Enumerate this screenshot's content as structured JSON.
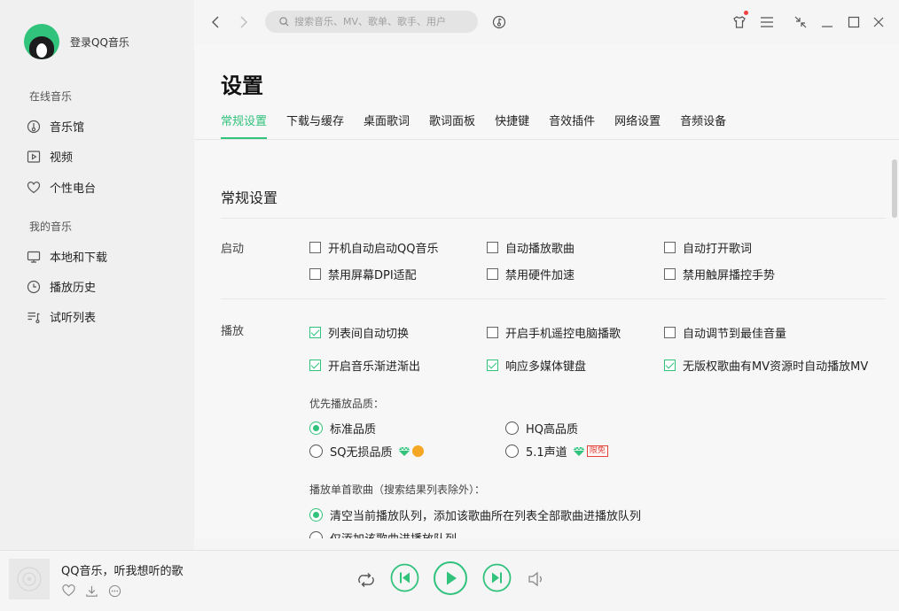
{
  "sidebar": {
    "login_text": "登录QQ音乐",
    "section_online": "在线音乐",
    "section_mine": "我的音乐",
    "items": [
      {
        "label": "音乐馆",
        "icon": "music-hall-icon"
      },
      {
        "label": "视频",
        "icon": "video-icon"
      },
      {
        "label": "个性电台",
        "icon": "heart-radio-icon"
      },
      {
        "label": "本地和下载",
        "icon": "monitor-icon"
      },
      {
        "label": "播放历史",
        "icon": "clock-icon"
      },
      {
        "label": "试听列表",
        "icon": "playlist-icon"
      }
    ]
  },
  "topbar": {
    "search_placeholder": "搜索音乐、MV、歌单、歌手、用户"
  },
  "settings": {
    "title": "设置",
    "tabs": [
      "常规设置",
      "下载与缓存",
      "桌面歌词",
      "歌词面板",
      "快捷键",
      "音效插件",
      "网络设置",
      "音频设备"
    ],
    "active_tab": "常规设置",
    "section_title": "常规设置",
    "startup": {
      "label": "启动",
      "options": [
        {
          "label": "开机自动启动QQ音乐",
          "checked": false
        },
        {
          "label": "自动播放歌曲",
          "checked": false
        },
        {
          "label": "自动打开歌词",
          "checked": false
        },
        {
          "label": "禁用屏幕DPI适配",
          "checked": false
        },
        {
          "label": "禁用硬件加速",
          "checked": false
        },
        {
          "label": "禁用触屏播控手势",
          "checked": false
        }
      ]
    },
    "playback": {
      "label": "播放",
      "options": [
        {
          "label": "列表间自动切换",
          "checked": true
        },
        {
          "label": "开启手机遥控电脑播歌",
          "checked": false
        },
        {
          "label": "自动调节到最佳音量",
          "checked": false
        },
        {
          "label": "开启音乐渐进渐出",
          "checked": true
        },
        {
          "label": "响应多媒体键盘",
          "checked": true
        },
        {
          "label": "无版权歌曲有MV资源时自动播放MV",
          "checked": true
        }
      ],
      "quality_label": "优先播放品质：",
      "quality_options": [
        {
          "label": "标准品质",
          "selected": true
        },
        {
          "label": "HQ高品质",
          "selected": false
        },
        {
          "label": "SQ无损品质",
          "selected": false
        },
        {
          "label": "5.1声道",
          "selected": false
        }
      ],
      "free_badge": "限免",
      "single_label": "播放单首歌曲（搜索结果列表除外）：",
      "single_options": [
        {
          "label": "清空当前播放队列，添加该歌曲所在列表全部歌曲进播放队列",
          "selected": true
        },
        {
          "label": "仅添加该歌曲进播放队列",
          "selected": false
        }
      ]
    }
  },
  "player": {
    "song_title": "QQ音乐，听我想听的歌"
  },
  "colors": {
    "accent": "#31c27c",
    "badge_red": "#e0433a"
  }
}
